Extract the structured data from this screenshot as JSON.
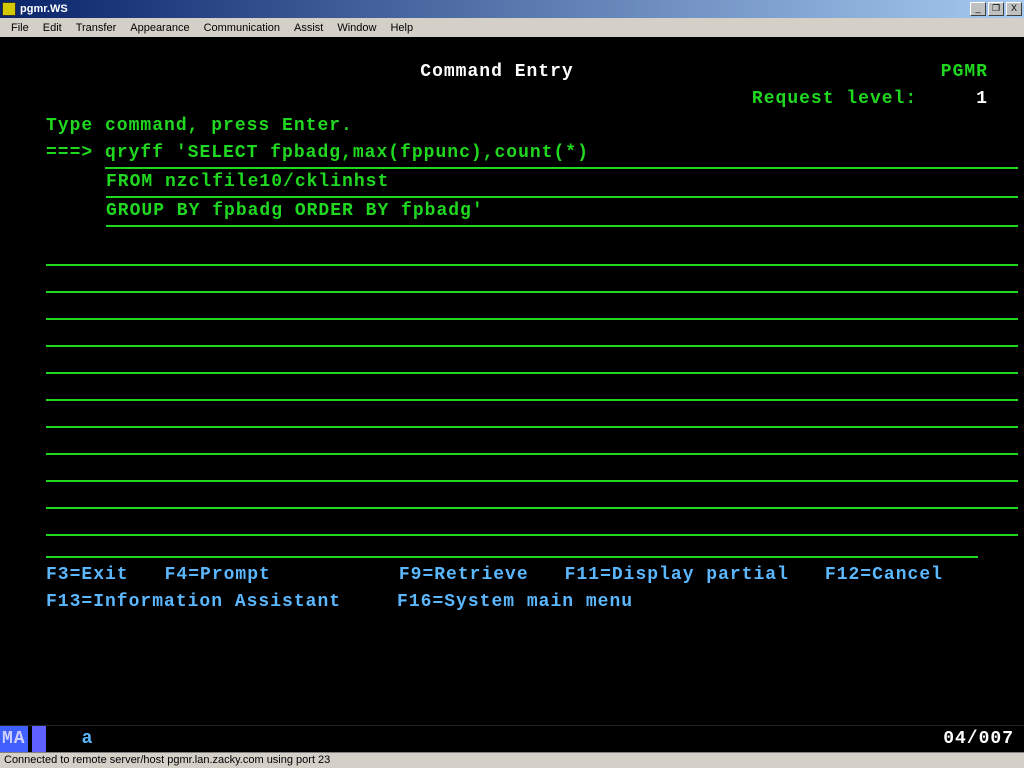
{
  "window": {
    "title": "pgmr.WS",
    "buttons": {
      "min": "_",
      "max": "❐",
      "close": "X"
    }
  },
  "menubar": [
    "File",
    "Edit",
    "Transfer",
    "Appearance",
    "Communication",
    "Assist",
    "Window",
    "Help"
  ],
  "screen": {
    "title": "Command Entry",
    "user": "PGMR",
    "request_level_label": "Request level:",
    "request_level_value": "1",
    "instruction": "Type command, press Enter.",
    "prompt": "===>",
    "cmd_lines": [
      "qryff 'SELECT fpbadg,max(fppunc),count(*)",
      "FROM nzclfile10/cklinhst",
      "GROUP BY fpbadg ORDER BY fpbadg'"
    ],
    "fkeys_row1": [
      "F3=Exit",
      "F4=Prompt",
      "F9=Retrieve",
      "F11=Display partial",
      "F12=Cancel"
    ],
    "fkeys_row2": [
      "F13=Information Assistant",
      "F16=System main menu"
    ],
    "status_ind": "MA",
    "status_a": "a",
    "cursor_pos": "04/007"
  },
  "winstatus": "Connected to remote server/host pgmr.lan.zacky.com using port 23"
}
